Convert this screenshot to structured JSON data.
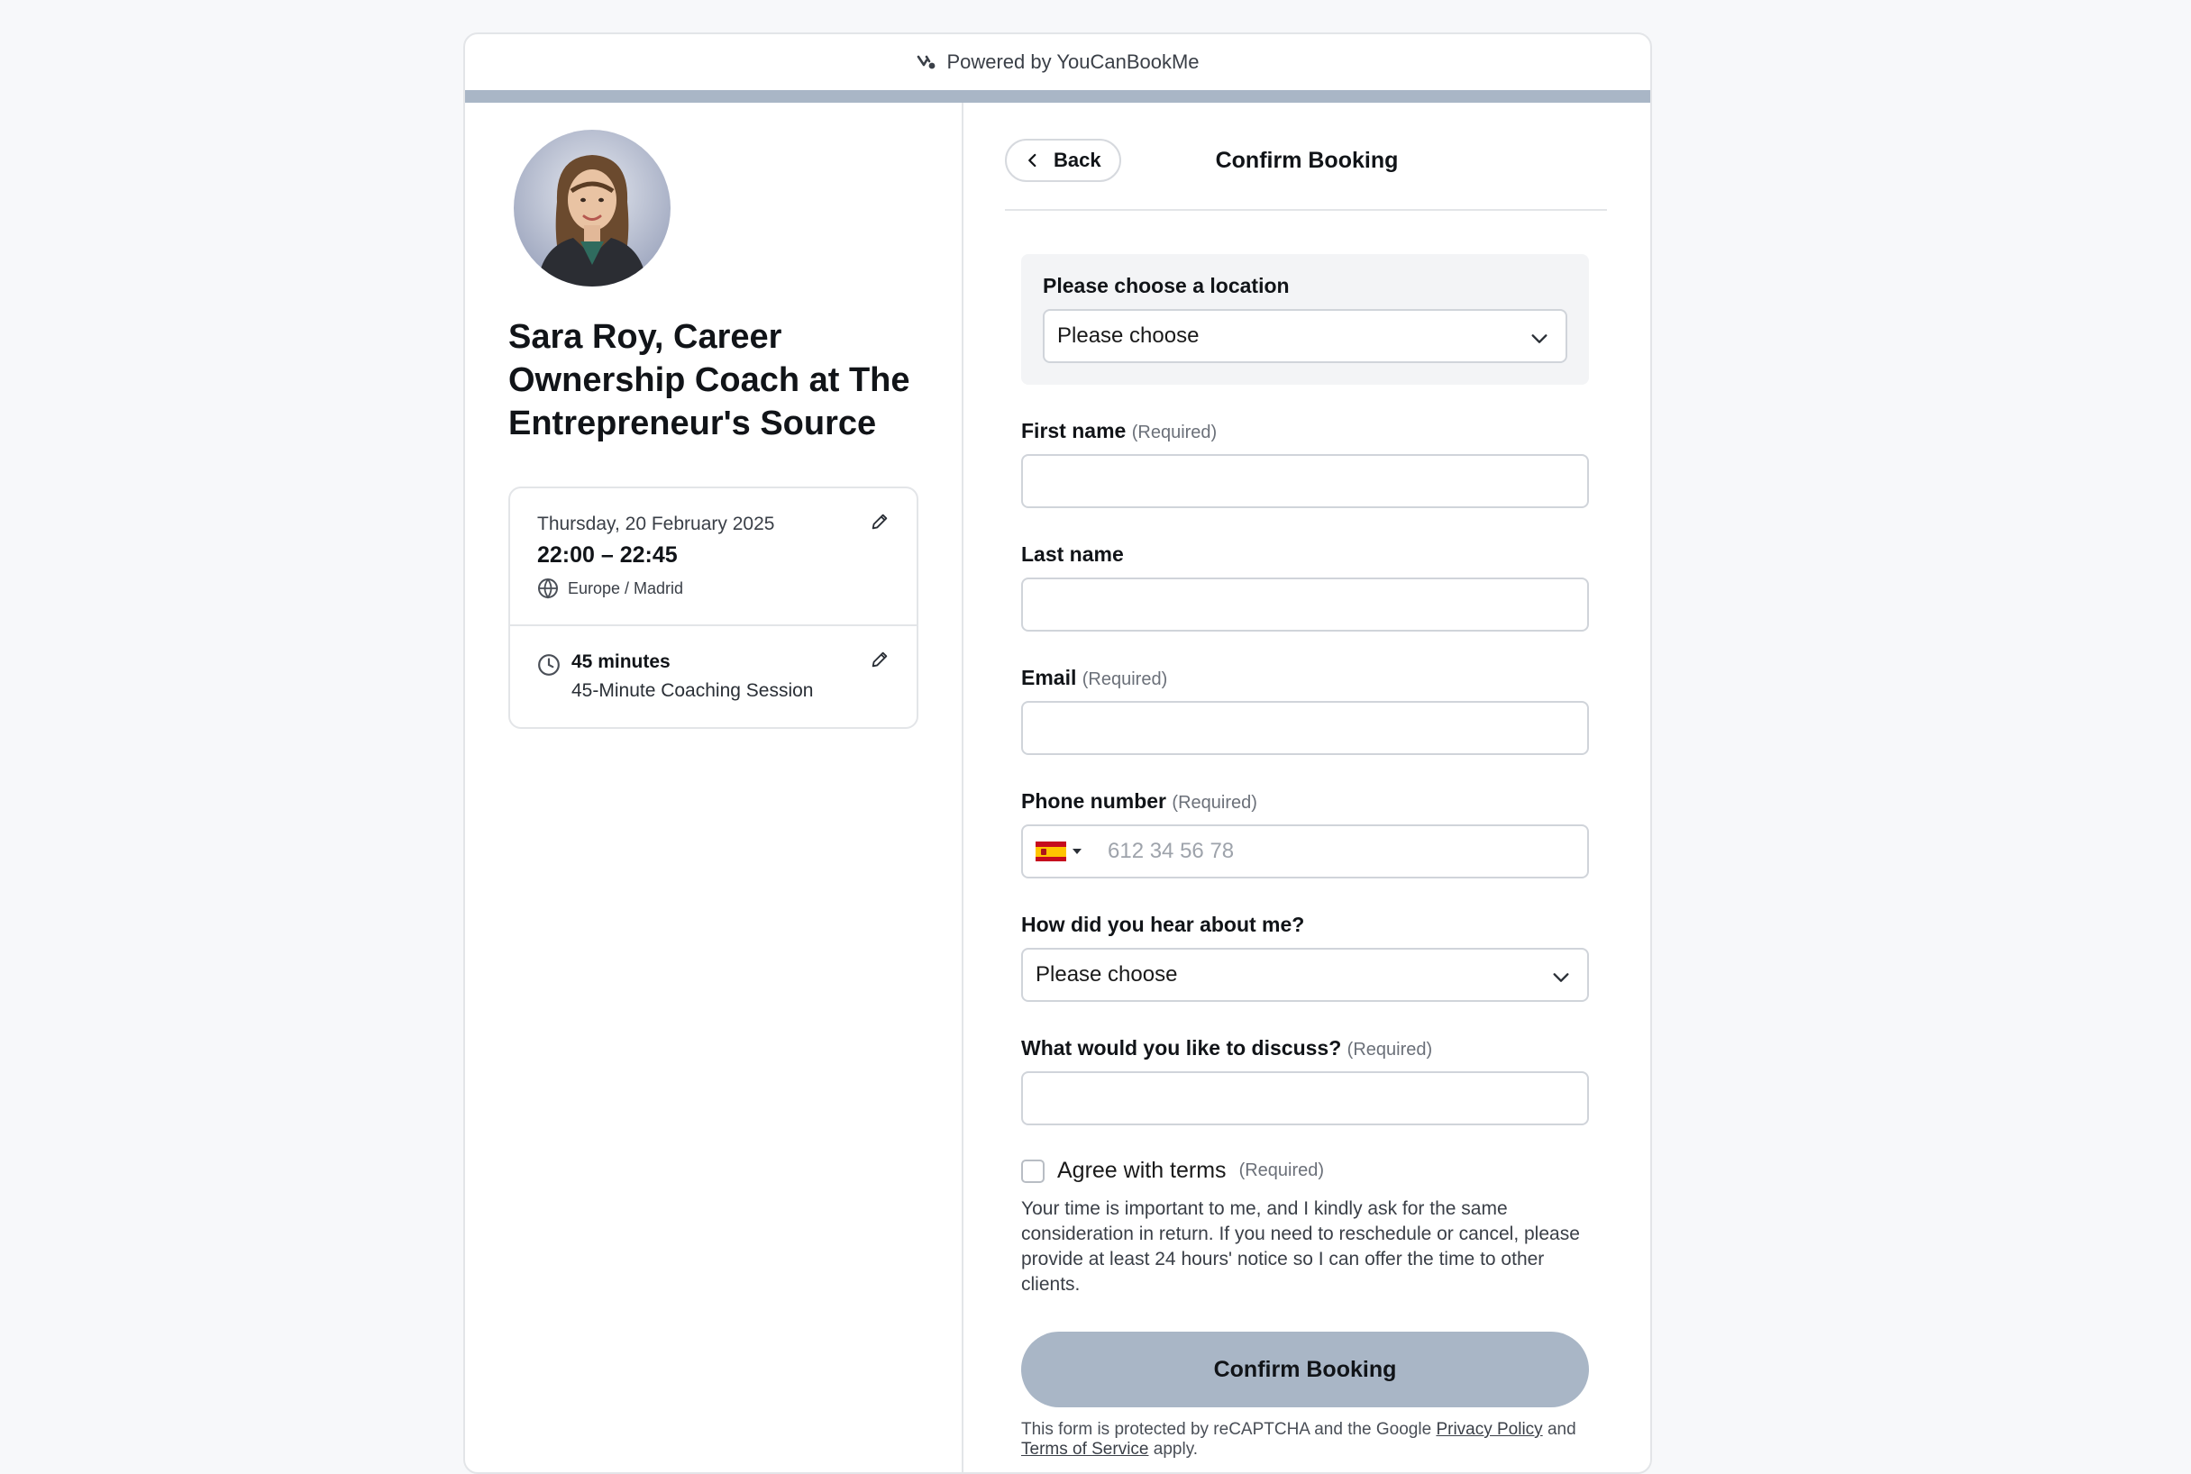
{
  "header": {
    "powered_by": "Powered by YouCanBookMe"
  },
  "profile": {
    "name": "Sara Roy, Career Ownership Coach at The Entrepreneur's Source"
  },
  "booking_summary": {
    "date": "Thursday, 20 February 2025",
    "time": "22:00 – 22:45",
    "timezone": "Europe / Madrid",
    "duration": "45 minutes",
    "session_name": "45-Minute Coaching Session"
  },
  "form_header": {
    "back_label": "Back",
    "title": "Confirm Booking"
  },
  "form": {
    "location": {
      "label": "Please choose a location",
      "value": "Please choose"
    },
    "first_name": {
      "label": "First name",
      "required": "(Required)",
      "value": ""
    },
    "last_name": {
      "label": "Last name",
      "value": ""
    },
    "email": {
      "label": "Email",
      "required": "(Required)",
      "value": ""
    },
    "phone": {
      "label": "Phone number",
      "required": "(Required)",
      "placeholder": "612 34 56 78",
      "country": "Spain"
    },
    "hear_about": {
      "label": "How did you hear about me?",
      "value": "Please choose"
    },
    "discuss": {
      "label": "What would you like to discuss?",
      "required": "(Required)",
      "value": ""
    },
    "agree": {
      "label": "Agree with terms",
      "required": "(Required)",
      "checked": false,
      "terms_text": "Your time is important to me, and I kindly ask for the same consideration in return. If you need to reschedule or cancel, please provide at least 24 hours' notice so I can offer the time to other clients."
    },
    "submit_label": "Confirm Booking",
    "recaptcha": {
      "prefix": "This form is protected by reCAPTCHA and the Google",
      "privacy_link": "Privacy Policy",
      "and": "and",
      "terms_link": "Terms of Service",
      "suffix": "apply."
    }
  },
  "colors": {
    "accent_bar": "#a9b6c6",
    "confirm_button": "#a9b6c6"
  }
}
